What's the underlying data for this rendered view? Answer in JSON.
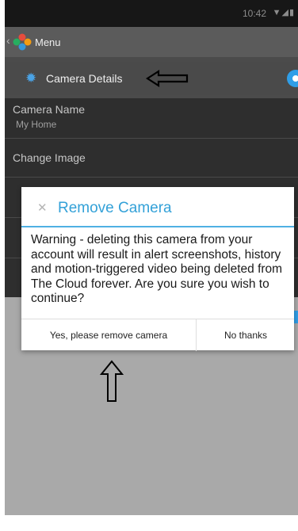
{
  "status_bar": {
    "time": "10:42",
    "icons": "▼◢▮"
  },
  "menu": {
    "label": "Menu"
  },
  "details_header": {
    "label": "Camera Details"
  },
  "settings_list": [
    {
      "title": "Camera Name",
      "value": "My Home"
    },
    {
      "title": "Change Image",
      "value": ""
    }
  ],
  "dialog": {
    "title": "Remove Camera",
    "message": "Warning - deleting this camera from your account will result in alert screenshots, history and motion-triggered video being deleted from The Cloud forever. Are you sure you wish to continue?",
    "confirm_label": "Yes, please remove camera",
    "cancel_label": "No thanks"
  },
  "colors": {
    "accent": "#33a1d8",
    "status_bar": "#171717",
    "list_background": "#2e2e2e",
    "overlay": "#a9a9a9"
  }
}
